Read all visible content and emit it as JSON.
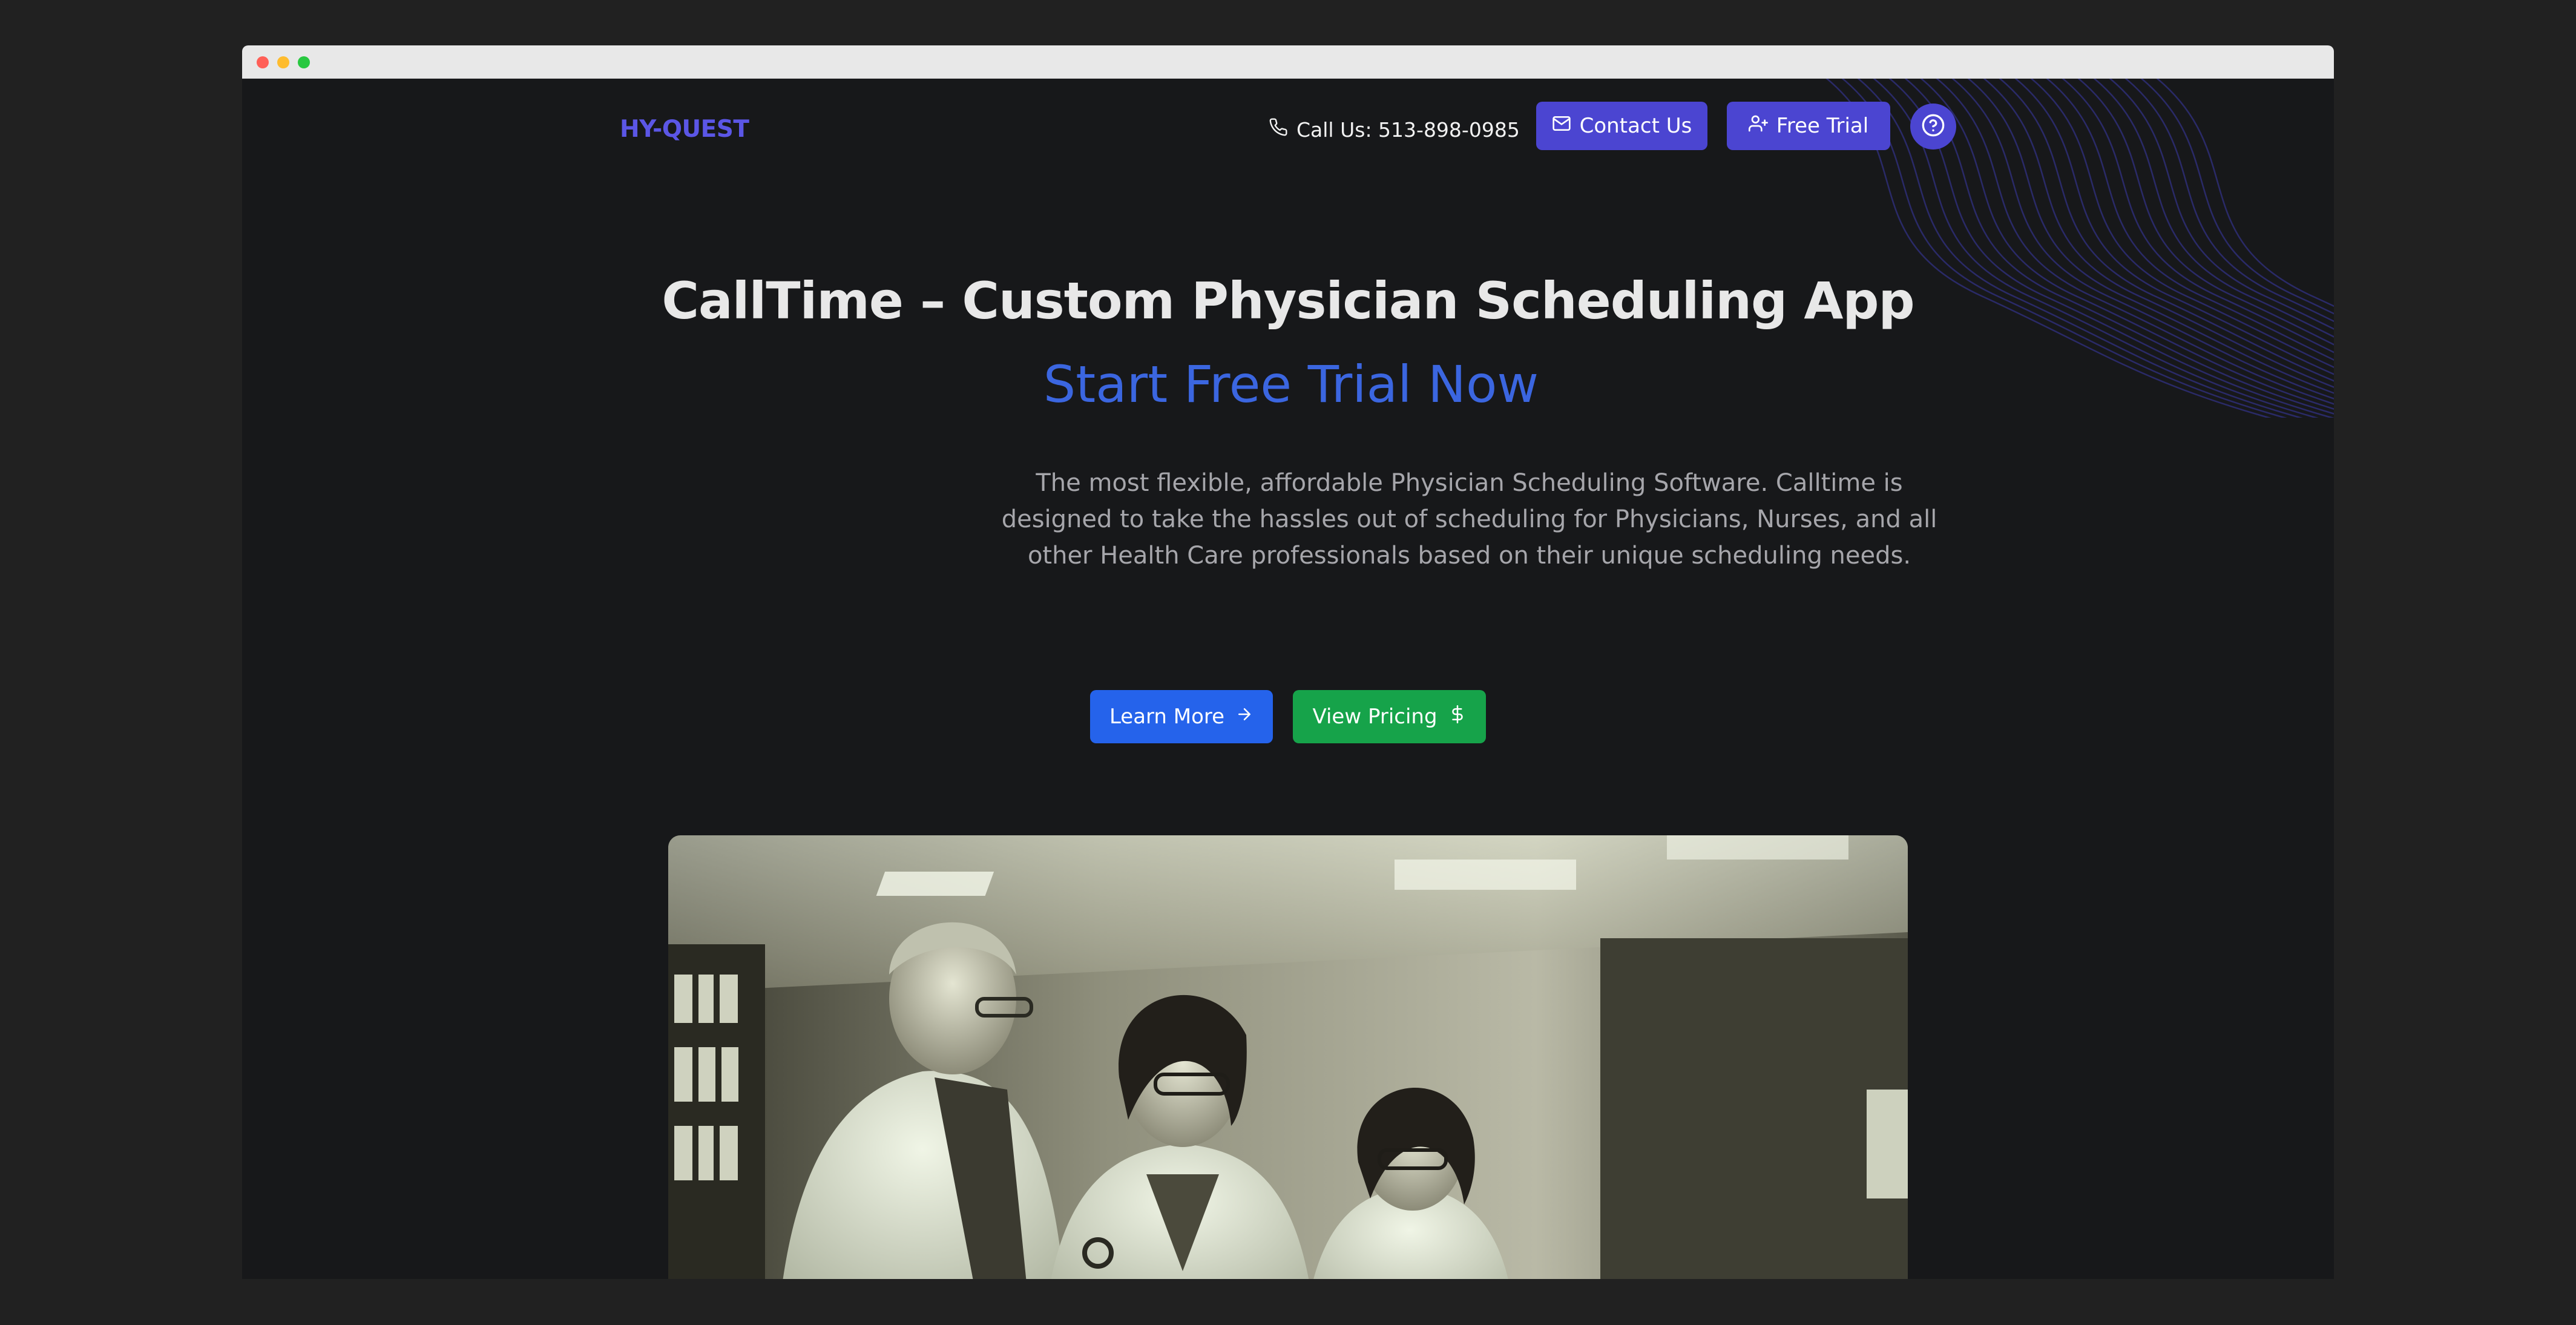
{
  "window": {
    "controls": [
      "close",
      "minimize",
      "maximize"
    ]
  },
  "nav": {
    "logo": "HY-QUEST",
    "phone_label": "Call Us: 513-898-0985",
    "contact_label": "Contact Us",
    "trial_label": "Free Trial",
    "icons": {
      "phone": "phone-icon",
      "contact": "mail-icon",
      "trial": "user-plus-icon",
      "help": "help-circle-icon"
    }
  },
  "hero": {
    "title": "CallTime – Custom Physician Scheduling App",
    "subtitle": "Start Free Trial Now",
    "description": "The most flexible, affordable Physician Scheduling Software. Calltime is designed to take the hassles out of scheduling for Physicians, Nurses, and all other Health Care professionals based on their unique scheduling needs.",
    "learn_more_label": "Learn More",
    "pricing_label": "View Pricing",
    "icons": {
      "learn_more": "arrow-right-icon",
      "pricing": "dollar-icon"
    }
  },
  "image": {
    "subject": "Three medical professionals in white coats reviewing a phone in a clinic"
  },
  "colors": {
    "background": "#17181a",
    "accent": "#4b45d1",
    "logo": "#5b56e6",
    "subtitle": "#3b66e0",
    "learn_more": "#2563eb",
    "pricing": "#16a34a"
  }
}
